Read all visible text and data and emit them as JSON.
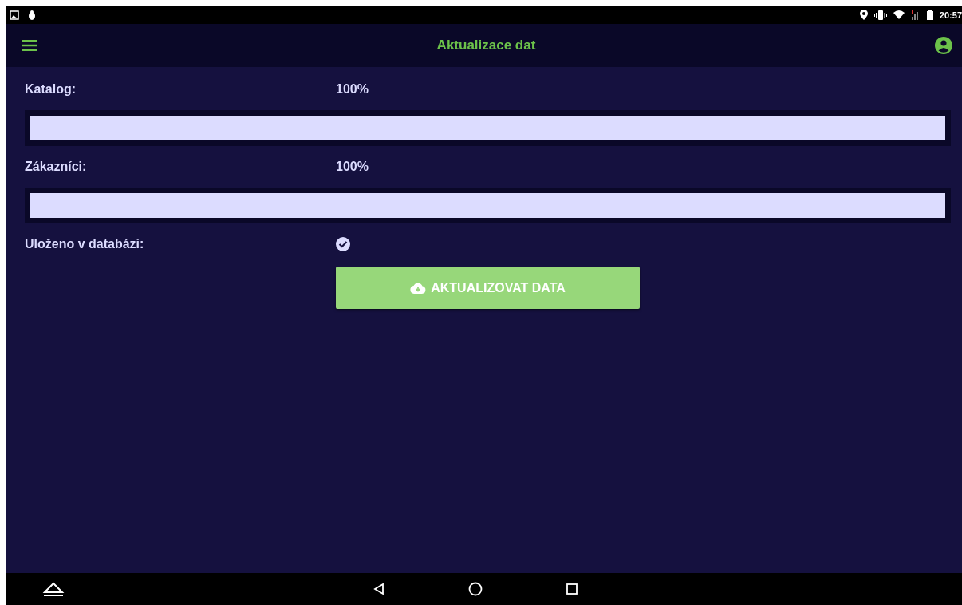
{
  "status_bar": {
    "time": "20:57"
  },
  "app_bar": {
    "title": "Aktualizace dat"
  },
  "progress": [
    {
      "label": "Katalog:",
      "reading": "100%",
      "level": 1
    },
    {
      "label": "Zákazníci:",
      "reading": "100%",
      "level": 1
    }
  ],
  "saved": {
    "label": "Uloženo v databázi:",
    "checked": true
  },
  "button": {
    "label": "AKTUALIZOVAT DATA"
  }
}
